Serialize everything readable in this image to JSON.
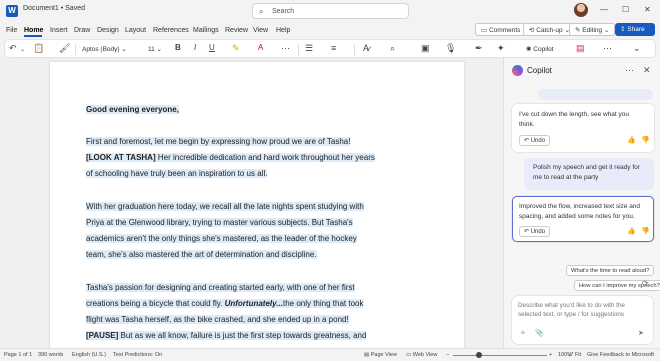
{
  "titlebar": {
    "doc_title": "Document1 • Saved",
    "search_placeholder": "Search"
  },
  "menu": [
    "File",
    "Home",
    "Insert",
    "Draw",
    "Design",
    "Layout",
    "References",
    "Mailings",
    "Review",
    "View",
    "Help"
  ],
  "menu_active": "Home",
  "menubar_buttons": {
    "comments": "Comments",
    "catchup": "Catch-up",
    "editing": "Editing",
    "share": "Share"
  },
  "toolbar": {
    "font_name": "Aptos (Body)",
    "font_size": "11",
    "copilot": "Copilot"
  },
  "document": {
    "greeting": "Good evening everyone,",
    "p1_l1": "First and foremost, let me begin by expressing how proud we are of Tasha!",
    "p1_l2_bold": "[LOOK AT TASHA]",
    "p1_l2_rest": " Her incredible dedication and hard work throughout her years",
    "p1_l3": "of schooling have truly been an inspiration to us all.",
    "p2_l1": "With her graduation here today, we recall all the late nights spent studying with",
    "p2_l2": "Priya at the Glenwood library, trying to master various subjects. But Tasha's",
    "p2_l3": "academics aren't the only things she's mastered, as the leader of the hockey",
    "p2_l4": "team, she's also mastered the art of determination and discipline.",
    "p3_l1": "Tasha's passion for designing and creating started early, with one of her first",
    "p3_l2_a": "creations being a bicycle that could fly. ",
    "p3_l2_b": "Unfortunately...",
    "p3_l2_c": "the only thing that took",
    "p3_l3": "flight was Tasha herself, as the bike crashed, and she ended up in a pond!",
    "p3_l4_bold": "[PAUSE]",
    "p3_l4_rest": " But as we all know, failure is just the first step towards greatness, and"
  },
  "copilot": {
    "title": "Copilot",
    "msg1": [
      "I've cut down the length, see what you",
      "think."
    ],
    "undo": "Undo",
    "user_msg": [
      "Polish my speech and get it ready for",
      "me to read at the party"
    ],
    "msg2": [
      "Improved the flow, increased text size and",
      "spacing, and added some notes for you."
    ],
    "suggestion1": "What's the time to read aloud?",
    "suggestion2": "How can I improve my speech?",
    "input_placeholder": "Describe what you'd like to do with the selected text, or type / for suggestions"
  },
  "statusbar": {
    "page": "Page 1 of 1",
    "words": "390 words",
    "language": "English (U.S.)",
    "predictions": "Text Predictions: On",
    "page_view": "Page View",
    "web_view": "Web View",
    "zoom": "100%",
    "fit": "Fit",
    "feedback": "Give Feedback to Microsoft"
  },
  "colors": {
    "brand": "#185abd",
    "highlight": "#dcebf7",
    "user_bubble": "#e8ebfa"
  }
}
